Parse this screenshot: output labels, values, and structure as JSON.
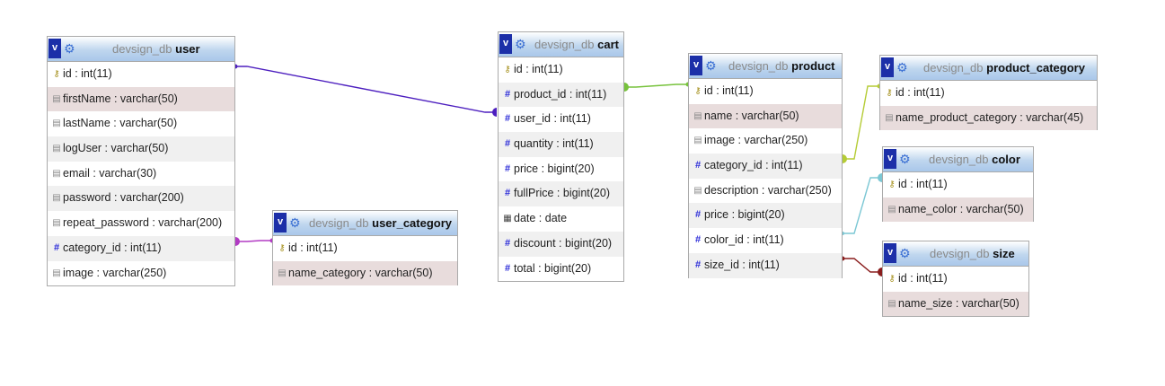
{
  "colors": {
    "user_link": "#4d1fbf",
    "user_category_link": "#b23bc4",
    "product_link": "#77c23b",
    "product_category_link": "#b5cc36",
    "color_link": "#7bc7d4",
    "size_link": "#8a1d1d",
    "pk_icon": "#a48f1a",
    "num_icon": "#2a2ad8",
    "header_toggle": "#1c2fa8",
    "highlight_row": "#e8dcdc"
  },
  "toggle_label": "v",
  "tables": {
    "user": {
      "db": "devsign_db",
      "name": "user",
      "columns": [
        {
          "text": "id : int(11)",
          "icon": "key-icon"
        },
        {
          "text": "firstName : varchar(50)",
          "icon": "text-field-icon"
        },
        {
          "text": "lastName : varchar(50)",
          "icon": "text-field-icon"
        },
        {
          "text": "logUser : varchar(50)",
          "icon": "text-field-icon"
        },
        {
          "text": "email : varchar(30)",
          "icon": "text-field-icon"
        },
        {
          "text": "password : varchar(200)",
          "icon": "text-field-icon"
        },
        {
          "text": "repeat_password : varchar(200)",
          "icon": "text-field-icon"
        },
        {
          "text": "category_id : int(11)",
          "icon": "numeric-field-icon"
        },
        {
          "text": "image : varchar(250)",
          "icon": "text-field-icon"
        }
      ]
    },
    "user_category": {
      "db": "devsign_db",
      "name": "user_category",
      "columns": [
        {
          "text": "id : int(11)",
          "icon": "key-icon"
        },
        {
          "text": "name_category : varchar(50)",
          "icon": "text-field-icon"
        }
      ]
    },
    "cart": {
      "db": "devsign_db",
      "name": "cart",
      "columns": [
        {
          "text": "id : int(11)",
          "icon": "key-icon"
        },
        {
          "text": "product_id : int(11)",
          "icon": "numeric-field-icon"
        },
        {
          "text": "user_id : int(11)",
          "icon": "numeric-field-icon"
        },
        {
          "text": "quantity : int(11)",
          "icon": "numeric-field-icon"
        },
        {
          "text": "price : bigint(20)",
          "icon": "numeric-field-icon"
        },
        {
          "text": "fullPrice : bigint(20)",
          "icon": "numeric-field-icon"
        },
        {
          "text": "date : date",
          "icon": "date-field-icon"
        },
        {
          "text": "discount : bigint(20)",
          "icon": "numeric-field-icon"
        },
        {
          "text": "total : bigint(20)",
          "icon": "numeric-field-icon"
        }
      ]
    },
    "product": {
      "db": "devsign_db",
      "name": "product",
      "columns": [
        {
          "text": "id : int(11)",
          "icon": "key-icon"
        },
        {
          "text": "name : varchar(50)",
          "icon": "text-field-icon"
        },
        {
          "text": "image : varchar(250)",
          "icon": "text-field-icon"
        },
        {
          "text": "category_id : int(11)",
          "icon": "numeric-field-icon"
        },
        {
          "text": "description : varchar(250)",
          "icon": "text-field-icon"
        },
        {
          "text": "price : bigint(20)",
          "icon": "numeric-field-icon"
        },
        {
          "text": "color_id : int(11)",
          "icon": "numeric-field-icon"
        },
        {
          "text": "size_id : int(11)",
          "icon": "numeric-field-icon"
        }
      ]
    },
    "product_category": {
      "db": "devsign_db",
      "name": "product_category",
      "columns": [
        {
          "text": "id : int(11)",
          "icon": "key-icon"
        },
        {
          "text": "name_product_category : varchar(45)",
          "icon": "text-field-icon"
        }
      ]
    },
    "color": {
      "db": "devsign_db",
      "name": "color",
      "columns": [
        {
          "text": "id : int(11)",
          "icon": "key-icon"
        },
        {
          "text": "name_color : varchar(50)",
          "icon": "text-field-icon"
        }
      ]
    },
    "size": {
      "db": "devsign_db",
      "name": "size",
      "columns": [
        {
          "text": "id : int(11)",
          "icon": "key-icon"
        },
        {
          "text": "name_size : varchar(50)",
          "icon": "text-field-icon"
        }
      ]
    }
  }
}
